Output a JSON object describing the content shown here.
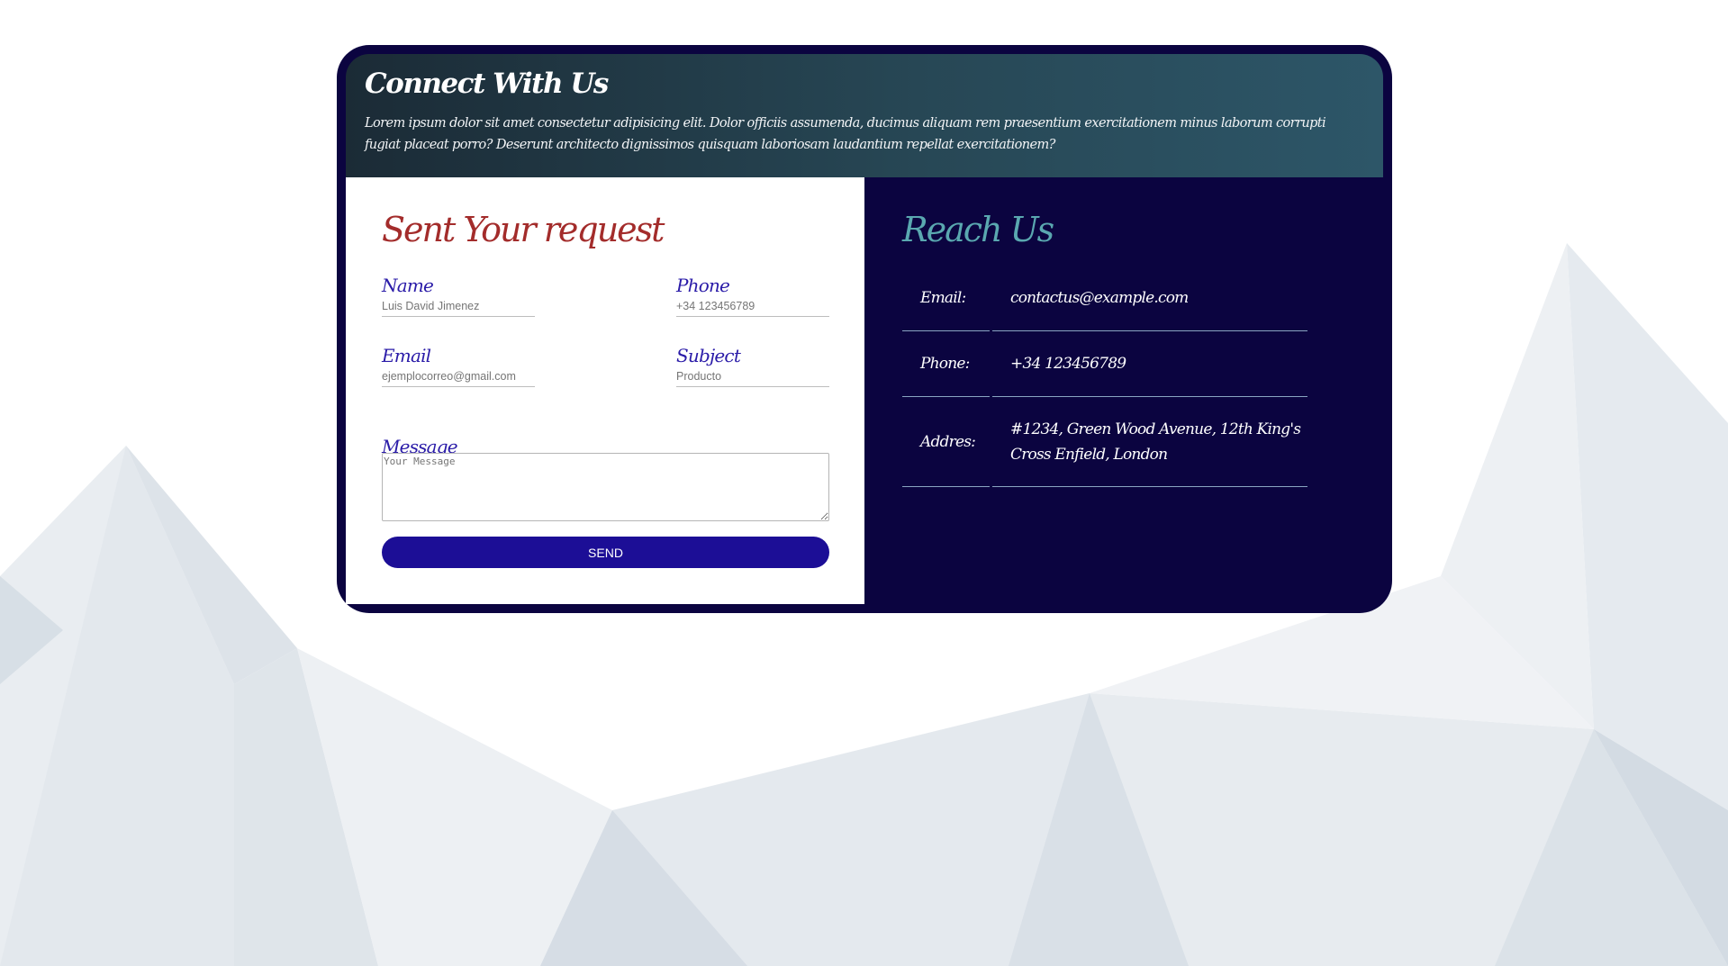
{
  "header": {
    "title": "Connect With Us",
    "description": "Lorem ipsum dolor sit amet consectetur adipisicing elit. Dolor officiis assumenda, ducimus aliquam rem praesentium exercitationem minus laborum corrupti fugiat placeat porro? Deserunt architecto dignissimos quisquam laboriosam laudantium repellat exercitationem?"
  },
  "form": {
    "title": "Sent Your request",
    "fields": {
      "name": {
        "label": "Name",
        "placeholder": "Luis David Jimenez"
      },
      "phone": {
        "label": "Phone",
        "placeholder": "+34 123456789"
      },
      "email": {
        "label": "Email",
        "placeholder": "ejemplocorreo@gmail.com"
      },
      "subject": {
        "label": "Subject",
        "placeholder": "Producto"
      }
    },
    "message": {
      "label": "Message",
      "placeholder": "Your Message"
    },
    "send_label": "SEND"
  },
  "reach": {
    "title": "Reach Us",
    "rows": [
      {
        "label": "Email:",
        "value": "contactus@example.com"
      },
      {
        "label": "Phone:",
        "value": "+34 123456789"
      },
      {
        "label": "Addres:",
        "value": "#1234, Green Wood Avenue, 12th King's Cross Enfield, London"
      }
    ]
  },
  "colors": {
    "card_background": "#0b0440",
    "header_gradient_start": "#1b2b36",
    "header_gradient_end": "#2d5668",
    "form_title": "#a32c2b",
    "field_label": "#2a1ba8",
    "send_button": "#1c0e96",
    "reach_title": "#5aa8b0"
  }
}
